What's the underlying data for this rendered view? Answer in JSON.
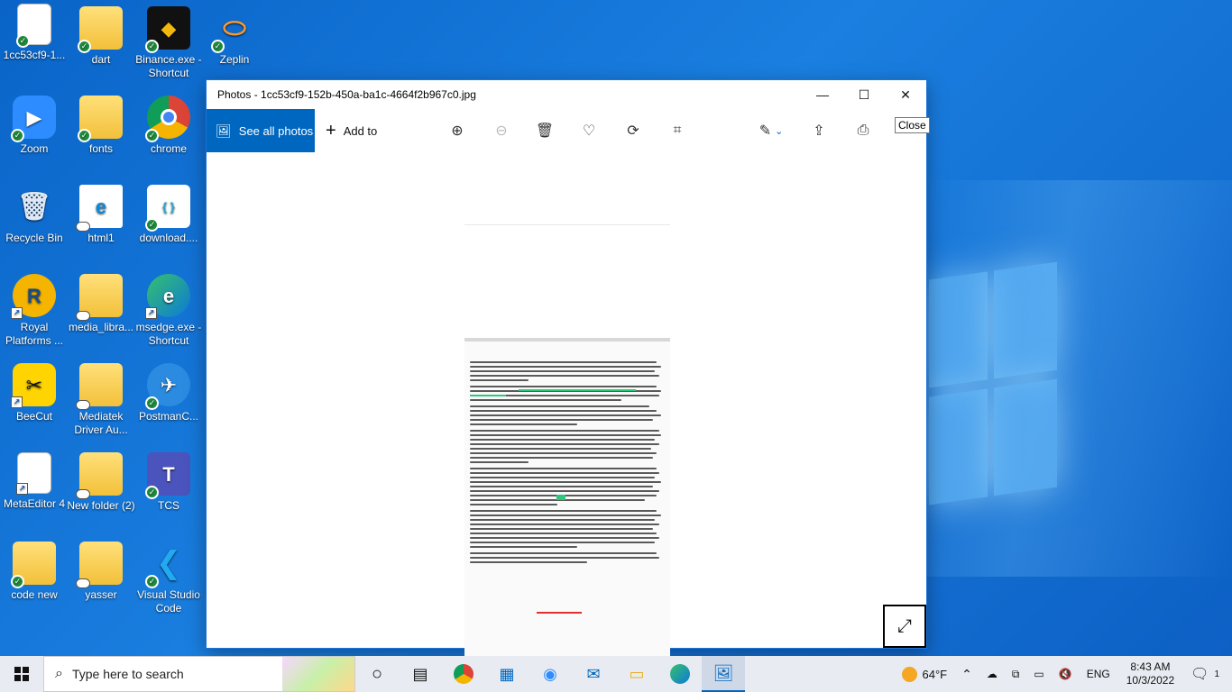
{
  "desktop": {
    "icons": [
      {
        "label": "1cc53cf9-1...",
        "icon": "image-file-icon"
      },
      {
        "label": "dart",
        "icon": "file-icon"
      },
      {
        "label": "Binance.exe - Shortcut",
        "icon": "binance-icon"
      },
      {
        "label": "Zeplin",
        "icon": "zeplin-icon"
      },
      {
        "label": "Zoom",
        "icon": "zoom-icon"
      },
      {
        "label": "fonts",
        "icon": "folder-icon"
      },
      {
        "label": "chrome",
        "icon": "chrome-icon"
      },
      {
        "label": "Recycle Bin",
        "icon": "recycle-bin-icon"
      },
      {
        "label": "html1",
        "icon": "edge-html-icon"
      },
      {
        "label": "download....",
        "icon": "download-image-icon"
      },
      {
        "label": "Royal Platforms ...",
        "icon": "royal-platforms-icon"
      },
      {
        "label": "media_libra...",
        "icon": "folder-icon"
      },
      {
        "label": "msedge.exe - Shortcut",
        "icon": "edge-icon"
      },
      {
        "label": "BeeCut",
        "icon": "beecut-icon"
      },
      {
        "label": "Mediatek Driver Au...",
        "icon": "folder-icon"
      },
      {
        "label": "PostmanC...",
        "icon": "postman-icon"
      },
      {
        "label": "MetaEditor 4",
        "icon": "file-icon"
      },
      {
        "label": "New folder (2)",
        "icon": "folder-icon"
      },
      {
        "label": "TCS",
        "icon": "teams-icon"
      },
      {
        "label": "code new",
        "icon": "folder-icon"
      },
      {
        "label": "yasser",
        "icon": "folder-icon"
      },
      {
        "label": "Visual Studio Code",
        "icon": "vscode-icon"
      }
    ]
  },
  "window": {
    "title": "Photos - 1cc53cf9-152b-450a-ba1c-4664f2b967c0.jpg",
    "minimize": "—",
    "maximize": "☐",
    "close": "✕",
    "see_all_photos": "See all photos",
    "add_to": "Add to",
    "tooltip": "Close"
  },
  "taskbar": {
    "search_placeholder": "Type here to search",
    "weather": "64°F",
    "language": "ENG",
    "time": "8:43 AM",
    "date": "10/3/2022",
    "notifications": "1"
  },
  "colors": {
    "accent": "#0067c0",
    "desktop_bg": "#0a64c8",
    "taskbar_bg": "#e8ecf2"
  }
}
